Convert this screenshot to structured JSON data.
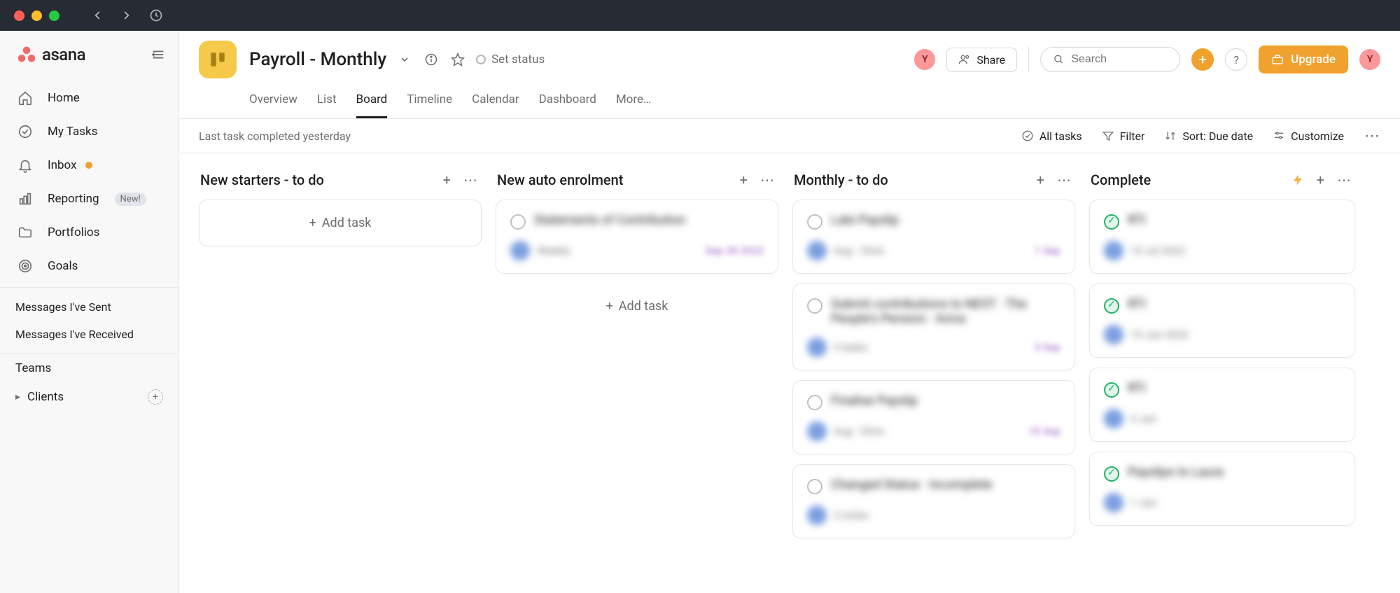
{
  "chrome": {},
  "sidebar": {
    "logo_text": "asana",
    "nav": {
      "home": "Home",
      "my_tasks": "My Tasks",
      "inbox": "Inbox",
      "reporting": "Reporting",
      "reporting_tag": "New!",
      "portfolios": "Portfolios",
      "goals": "Goals"
    },
    "messages_sent": "Messages I've Sent",
    "messages_received": "Messages I've Received",
    "teams_header": "Teams",
    "team_clients": "Clients"
  },
  "header": {
    "project_title": "Payroll - Monthly",
    "set_status": "Set status",
    "share": "Share",
    "search_placeholder": "Search",
    "upgrade": "Upgrade",
    "avatar_initial": "Y",
    "tabs": {
      "overview": "Overview",
      "list": "List",
      "board": "Board",
      "timeline": "Timeline",
      "calendar": "Calendar",
      "dashboard": "Dashboard",
      "more": "More…"
    }
  },
  "toolbar": {
    "last_completed": "Last task completed yesterday",
    "all_tasks": "All tasks",
    "filter": "Filter",
    "sort": "Sort: Due date",
    "customize": "Customize"
  },
  "columns": [
    {
      "title": "New starters - to do",
      "add_label": "Add task",
      "cards": []
    },
    {
      "title": "New auto enrolment",
      "add_label": "Add task",
      "cards": [
        {
          "done": false,
          "title": "Statements of Contribution",
          "meta": "Weekly",
          "due": "Sep 28 2022"
        }
      ]
    },
    {
      "title": "Monthly - to do",
      "cards": [
        {
          "done": false,
          "title": "Late Payslip",
          "meta": "Aug · Chris",
          "due": "1 Sep"
        },
        {
          "done": false,
          "title": "Submit contributions to NEST · The People's Pension · Aviva",
          "meta": "3 tasks",
          "due": "3 Sep"
        },
        {
          "done": false,
          "title": "Finalise Payslip",
          "meta": "Aug · Chris",
          "due": "15 Sep"
        },
        {
          "done": false,
          "title": "Changed Status · Incomplete",
          "meta": "2 notes",
          "due": ""
        }
      ]
    },
    {
      "title": "Complete",
      "cards": [
        {
          "done": true,
          "title": "RTI",
          "meta": "15 Jul 2022",
          "due": ""
        },
        {
          "done": true,
          "title": "RTI",
          "meta": "15 Jun 2022",
          "due": ""
        },
        {
          "done": true,
          "title": "RTI",
          "meta": "3 Jun",
          "due": ""
        },
        {
          "done": true,
          "title": "Payslips to Laura",
          "meta": "1 Jun",
          "due": ""
        }
      ]
    }
  ]
}
